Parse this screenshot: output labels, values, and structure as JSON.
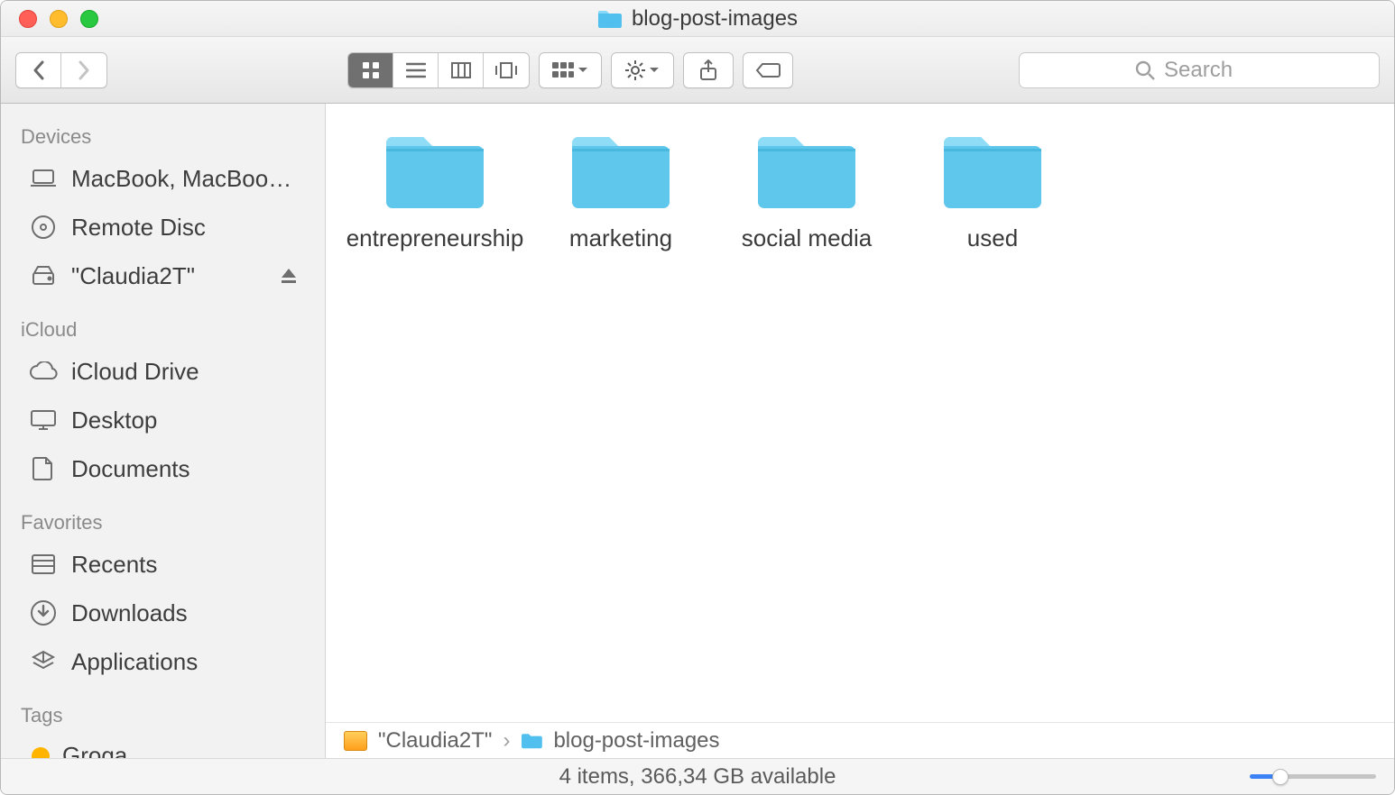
{
  "window": {
    "title": "blog-post-images"
  },
  "search": {
    "placeholder": "Search"
  },
  "sidebar": {
    "sections": [
      {
        "header": "Devices",
        "items": [
          {
            "icon": "laptop",
            "label": "MacBook, MacBook..."
          },
          {
            "icon": "disc",
            "label": "Remote Disc"
          },
          {
            "icon": "hdd",
            "label": "\"Claudia2T\"",
            "eject": true
          }
        ]
      },
      {
        "header": "iCloud",
        "items": [
          {
            "icon": "cloud",
            "label": "iCloud Drive"
          },
          {
            "icon": "desktop",
            "label": "Desktop"
          },
          {
            "icon": "doc",
            "label": "Documents"
          }
        ]
      },
      {
        "header": "Favorites",
        "items": [
          {
            "icon": "recents",
            "label": "Recents"
          },
          {
            "icon": "download",
            "label": "Downloads"
          },
          {
            "icon": "apps",
            "label": "Applications"
          }
        ]
      },
      {
        "header": "Tags",
        "items": [
          {
            "icon": "tagdot",
            "label": "Groga"
          }
        ]
      }
    ]
  },
  "folders": [
    {
      "name": "entrepreneurship"
    },
    {
      "name": "marketing"
    },
    {
      "name": "social media"
    },
    {
      "name": "used"
    }
  ],
  "path": {
    "seg0": "\"Claudia2T\"",
    "seg1": "blog-post-images"
  },
  "status": {
    "text": "4 items, 366,34 GB available"
  }
}
